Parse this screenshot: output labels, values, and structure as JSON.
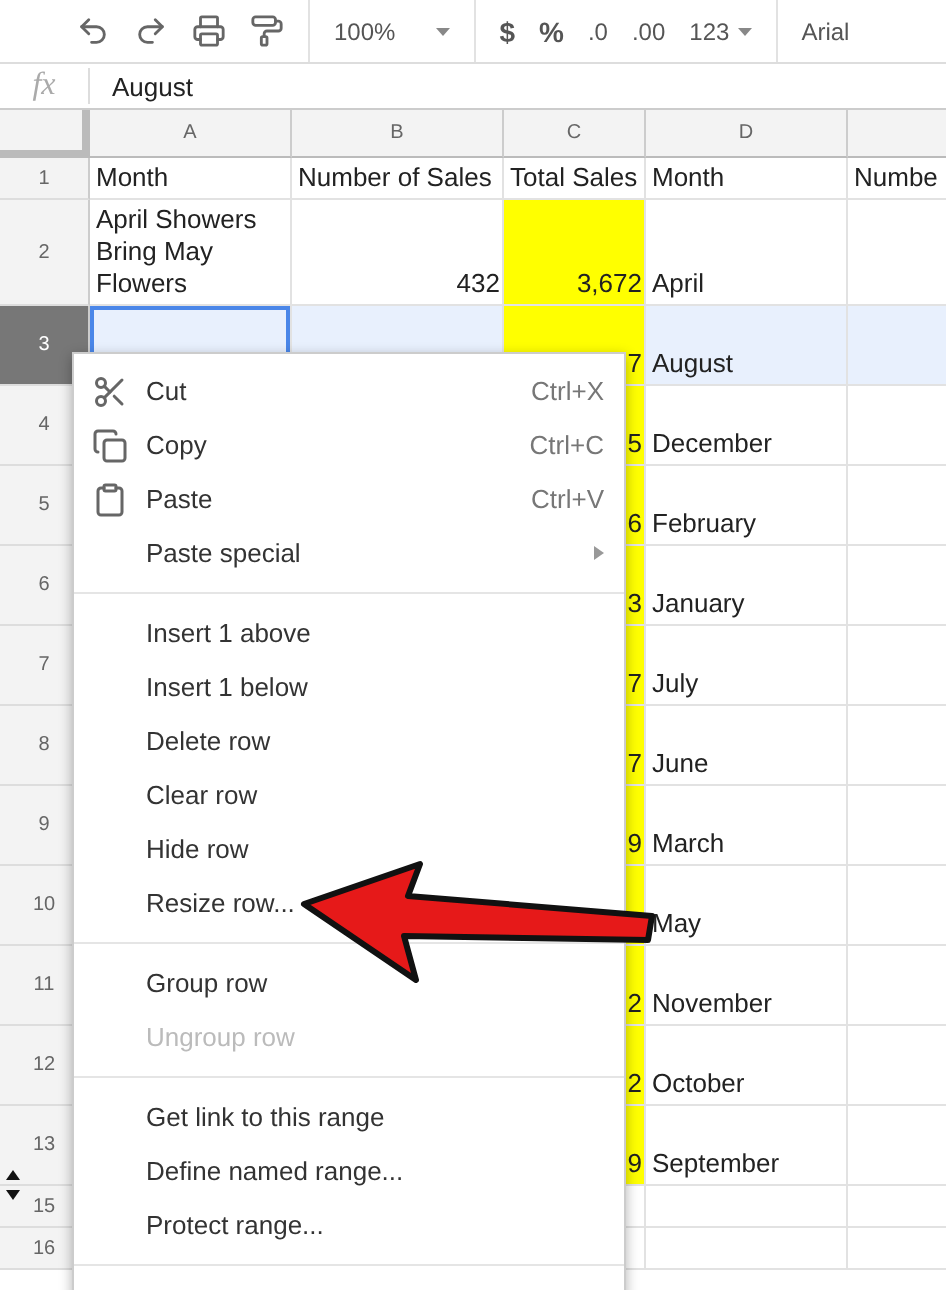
{
  "toolbar": {
    "zoom": "100%",
    "currency": "$",
    "percent": "%",
    "decrease_decimals": ".0",
    "increase_decimals": ".00",
    "number_format": "123",
    "font": "Arial"
  },
  "formula_bar": {
    "label": "fx",
    "value": "August"
  },
  "columns": [
    "A",
    "B",
    "C",
    "D"
  ],
  "rows": [
    {
      "header": "1",
      "selected": false,
      "tall": false,
      "cells": [
        {
          "text": "Month"
        },
        {
          "text": "Number of Sales"
        },
        {
          "text": "Total Sales"
        },
        {
          "text": "Month"
        },
        {
          "text": "Numbe"
        }
      ]
    },
    {
      "header": "2",
      "selected": false,
      "tall": false,
      "cells": [
        {
          "text": "April Showers Bring May Flowers"
        },
        {
          "text": "432",
          "right_aligned": true
        },
        {
          "text": "3,672",
          "right_aligned": true,
          "highlighted": true
        },
        {
          "text": "April"
        },
        {}
      ]
    },
    {
      "header": "3",
      "selected": true,
      "tall": true,
      "cells": [
        {
          "active": true
        },
        {},
        {
          "text": "7",
          "right_aligned": true,
          "highlighted": true
        },
        {
          "text": "August"
        },
        {}
      ]
    },
    {
      "header": "4",
      "selected": false,
      "tall": true,
      "cells": [
        {},
        {},
        {
          "text": "5",
          "right_aligned": true,
          "highlighted": true
        },
        {
          "text": "December"
        },
        {}
      ]
    },
    {
      "header": "5",
      "selected": false,
      "tall": true,
      "cells": [
        {},
        {},
        {
          "text": "6",
          "right_aligned": true,
          "highlighted": true
        },
        {
          "text": "February"
        },
        {}
      ]
    },
    {
      "header": "6",
      "selected": false,
      "tall": true,
      "cells": [
        {},
        {},
        {
          "text": "3",
          "right_aligned": true,
          "highlighted": true
        },
        {
          "text": "January"
        },
        {}
      ]
    },
    {
      "header": "7",
      "selected": false,
      "tall": true,
      "cells": [
        {},
        {},
        {
          "text": "7",
          "right_aligned": true,
          "highlighted": true
        },
        {
          "text": "July"
        },
        {}
      ]
    },
    {
      "header": "8",
      "selected": false,
      "tall": true,
      "cells": [
        {},
        {},
        {
          "text": "7",
          "right_aligned": true,
          "highlighted": true
        },
        {
          "text": "June"
        },
        {}
      ]
    },
    {
      "header": "9",
      "selected": false,
      "tall": true,
      "cells": [
        {},
        {},
        {
          "text": "9",
          "right_aligned": true,
          "highlighted": true
        },
        {
          "text": "March"
        },
        {}
      ]
    },
    {
      "header": "10",
      "selected": false,
      "tall": true,
      "cells": [
        {},
        {},
        {
          "highlighted": true
        },
        {
          "text": "May"
        },
        {}
      ]
    },
    {
      "header": "11",
      "selected": false,
      "tall": true,
      "cells": [
        {},
        {},
        {
          "text": "2",
          "right_aligned": true,
          "highlighted": true
        },
        {
          "text": "November"
        },
        {}
      ]
    },
    {
      "header": "12",
      "selected": false,
      "tall": true,
      "cells": [
        {},
        {},
        {
          "text": "2",
          "right_aligned": true,
          "highlighted": true
        },
        {
          "text": "October"
        },
        {}
      ]
    },
    {
      "header": "13",
      "selected": false,
      "tall": true,
      "hidden_below": true,
      "cells": [
        {},
        {},
        {
          "text": "9",
          "right_aligned": true,
          "highlighted": true
        },
        {
          "text": "September"
        },
        {}
      ]
    },
    {
      "header": "15",
      "selected": false,
      "tall": false,
      "hidden_above": true,
      "cells": [
        {},
        {},
        {},
        {},
        {}
      ]
    },
    {
      "header": "16",
      "selected": false,
      "tall": false,
      "cells": [
        {},
        {},
        {},
        {},
        {}
      ]
    }
  ],
  "context_menu": [
    {
      "kind": "item",
      "label": "Cut",
      "shortcut": "Ctrl+X",
      "disabled": false
    },
    {
      "kind": "item",
      "label": "Copy",
      "shortcut": "Ctrl+C",
      "disabled": false
    },
    {
      "kind": "item",
      "label": "Paste",
      "shortcut": "Ctrl+V",
      "disabled": false
    },
    {
      "kind": "item",
      "label": "Paste special",
      "submenu": true,
      "disabled": false
    },
    {
      "kind": "separator"
    },
    {
      "kind": "item",
      "label": "Insert 1 above",
      "disabled": false
    },
    {
      "kind": "item",
      "label": "Insert 1 below",
      "disabled": false
    },
    {
      "kind": "item",
      "label": "Delete row",
      "disabled": false
    },
    {
      "kind": "item",
      "label": "Clear row",
      "disabled": false
    },
    {
      "kind": "item",
      "label": "Hide row",
      "disabled": false
    },
    {
      "kind": "item",
      "label": "Resize row...",
      "disabled": false
    },
    {
      "kind": "separator"
    },
    {
      "kind": "item",
      "label": "Group row",
      "disabled": false
    },
    {
      "kind": "item",
      "label": "Ungroup row",
      "disabled": true
    },
    {
      "kind": "separator"
    },
    {
      "kind": "item",
      "label": "Get link to this range",
      "disabled": false
    },
    {
      "kind": "item",
      "label": "Define named range...",
      "disabled": false
    },
    {
      "kind": "item",
      "label": "Protect range...",
      "disabled": false
    },
    {
      "kind": "separator"
    }
  ]
}
